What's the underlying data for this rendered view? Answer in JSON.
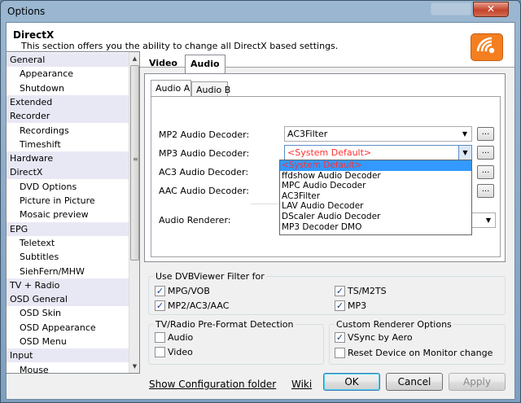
{
  "window": {
    "title": "Options",
    "close_label": "✕"
  },
  "header": {
    "title": "DirectX",
    "description": "This section offers you the ability to change all DirectX based settings."
  },
  "sidebar": {
    "items": [
      {
        "label": "General",
        "level": 0
      },
      {
        "label": "Appearance",
        "level": 1
      },
      {
        "label": "Shutdown",
        "level": 1
      },
      {
        "label": "Extended",
        "level": 0
      },
      {
        "label": "Recorder",
        "level": 0
      },
      {
        "label": "Recordings",
        "level": 1
      },
      {
        "label": "Timeshift",
        "level": 1
      },
      {
        "label": "Hardware",
        "level": 0
      },
      {
        "label": "DirectX",
        "level": 0
      },
      {
        "label": "DVD Options",
        "level": 1
      },
      {
        "label": "Picture in Picture",
        "level": 1
      },
      {
        "label": "Mosaic preview",
        "level": 1
      },
      {
        "label": "EPG",
        "level": 0
      },
      {
        "label": "Teletext",
        "level": 1
      },
      {
        "label": "Subtitles",
        "level": 1
      },
      {
        "label": "SiehFern/MHW",
        "level": 1
      },
      {
        "label": "TV + Radio",
        "level": 0
      },
      {
        "label": "OSD General",
        "level": 0
      },
      {
        "label": "OSD Skin",
        "level": 1
      },
      {
        "label": "OSD Appearance",
        "level": 1
      },
      {
        "label": "OSD Menu",
        "level": 1
      },
      {
        "label": "Input",
        "level": 0
      },
      {
        "label": "Mouse",
        "level": 1
      }
    ],
    "scroll_grip": "≡"
  },
  "tabs": {
    "video": "Video",
    "audio": "Audio",
    "active": "Audio"
  },
  "subtabs": {
    "a": "Audio A",
    "b": "Audio B",
    "active": "Audio A"
  },
  "audio": {
    "mp2_label": "MP2 Audio Decoder:",
    "mp2_value": "AC3Filter",
    "mp3_label": "MP3 Audio Decoder:",
    "mp3_value": "<System Default>",
    "ac3_label": "AC3 Audio Decoder:",
    "aac_label": "AAC Audio Decoder:",
    "renderer_label": "Audio Renderer:",
    "dots": "...",
    "dropdown_options": [
      "<System Default>",
      "ffdshow Audio Decoder",
      "MPC Audio Decoder",
      "AC3Filter",
      "LAV Audio Decoder",
      "DScaler Audio Decoder",
      "MP3 Decoder DMO"
    ],
    "dropdown_selected": 0
  },
  "dvb_filter": {
    "title": "Use DVBViewer Filter for",
    "items": [
      {
        "label": "MPG/VOB",
        "checked": true
      },
      {
        "label": "TS/M2TS",
        "checked": true
      },
      {
        "label": "MP2/AC3/AAC",
        "checked": true
      },
      {
        "label": "MP3",
        "checked": true
      }
    ]
  },
  "preformat": {
    "title": "TV/Radio Pre-Format Detection",
    "items": [
      {
        "label": "Audio",
        "checked": false
      },
      {
        "label": "Video",
        "checked": false
      }
    ]
  },
  "renderer_opts": {
    "title": "Custom Renderer Options",
    "items": [
      {
        "label": "VSync by Aero",
        "checked": true
      },
      {
        "label": "Reset Device on Monitor change",
        "checked": false
      }
    ]
  },
  "footer": {
    "config_link": "Show Configuration folder",
    "wiki": "Wiki",
    "ok": "OK",
    "cancel": "Cancel",
    "apply": "Apply"
  },
  "colors": {
    "accent": "#3399ff",
    "logo": "#f47f20",
    "selected_text": "#ff3030"
  },
  "icons": {
    "logo": "dvbviewer-logo-icon",
    "close": "close-icon",
    "dropdown": "chevron-down-icon"
  }
}
